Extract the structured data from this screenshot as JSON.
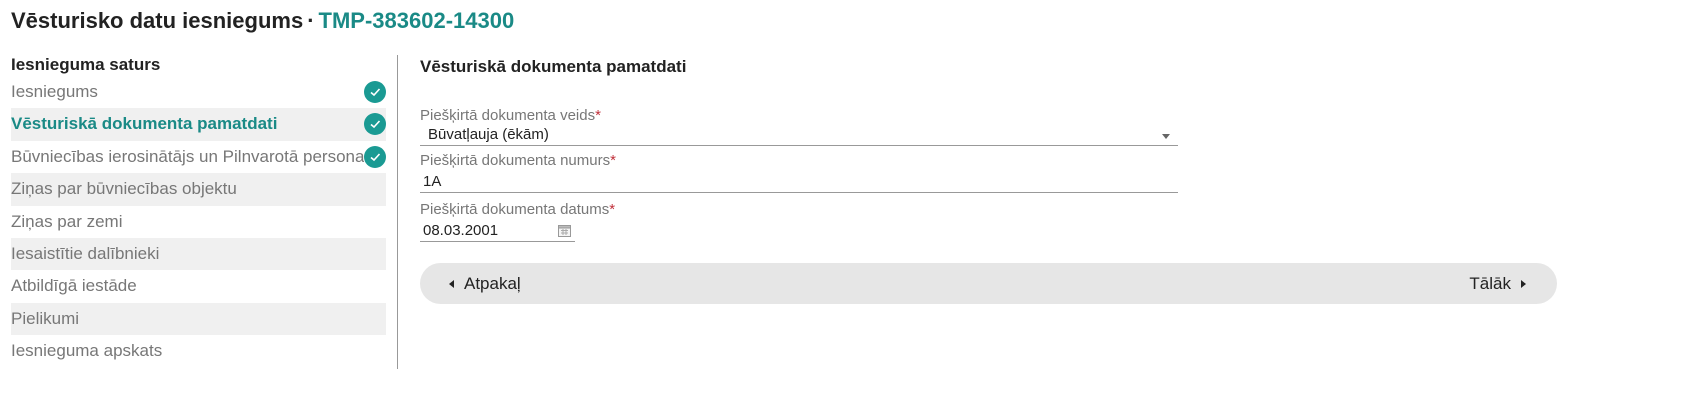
{
  "page": {
    "title": "Vēsturisko datu iesniegums",
    "separator": "·",
    "reference": "TMP-383602-14300"
  },
  "colors": {
    "accent": "#1a8a86",
    "check": "#1a9a93",
    "required": "#c0303a",
    "nav_bar": "#e6e6e6"
  },
  "sidebar": {
    "heading": "Iesnieguma saturs",
    "items": [
      {
        "label": "Iesniegums",
        "completed": true,
        "active": false
      },
      {
        "label": "Vēsturiskā dokumenta pamatdati",
        "completed": true,
        "active": true
      },
      {
        "label": "Būvniecības ierosinātājs un Pilnvarotā persona",
        "completed": true,
        "active": false
      },
      {
        "label": "Ziņas par būvniecības objektu",
        "completed": false,
        "active": false
      },
      {
        "label": "Ziņas par zemi",
        "completed": false,
        "active": false
      },
      {
        "label": "Iesaistītie dalībnieki",
        "completed": false,
        "active": false
      },
      {
        "label": "Atbildīgā iestāde",
        "completed": false,
        "active": false
      },
      {
        "label": "Pielikumi",
        "completed": false,
        "active": false
      },
      {
        "label": "Iesnieguma apskats",
        "completed": false,
        "active": false
      }
    ],
    "check_icon": "check-circle-icon"
  },
  "main": {
    "section_title": "Vēsturiskā dokumenta pamatdati",
    "fields": {
      "doc_type": {
        "label": "Piešķirtā dokumenta veids",
        "required_mark": "*",
        "value": "Būvatļauja (ēkām)"
      },
      "doc_number": {
        "label": "Piešķirtā dokumenta numurs",
        "required_mark": "*",
        "value": "1A"
      },
      "doc_date": {
        "label": "Piešķirtā dokumenta datums",
        "required_mark": "*",
        "value": "08.03.2001"
      }
    }
  },
  "navigation": {
    "back_label": "Atpakaļ",
    "next_label": "Tālāk"
  }
}
